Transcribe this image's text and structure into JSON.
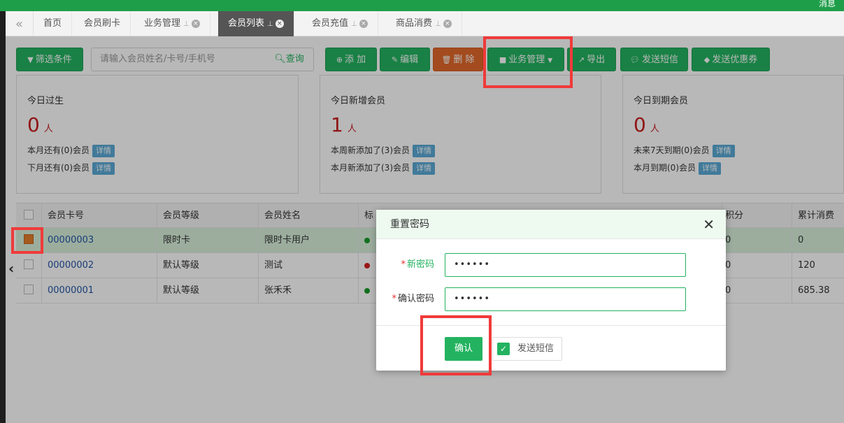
{
  "topbar": {
    "message": "消息"
  },
  "tabs": [
    {
      "label": "首页",
      "active": false
    },
    {
      "label": "会员刷卡",
      "active": false
    },
    {
      "label": "业务管理",
      "active": false
    },
    {
      "label": "会员列表",
      "active": true
    },
    {
      "label": "会员充值",
      "active": false
    },
    {
      "label": "商品消费",
      "active": false
    }
  ],
  "toolbar": {
    "filter_label": "筛选条件",
    "search_placeholder": "请输入会员姓名/卡号/手机号",
    "search_button": "查询",
    "add_label": "添 加",
    "edit_label": "编辑",
    "delete_label": "删 除",
    "business_label": "业务管理",
    "export_label": "导出",
    "sms_label": "发送短信",
    "coupon_label": "发送优惠券"
  },
  "cards": [
    {
      "title": "今日过生",
      "number": "0",
      "unit": "人",
      "lines": [
        {
          "text": "本月还有(0)会员",
          "badge": "详情"
        },
        {
          "text": "下月还有(0)会员",
          "badge": "详情"
        }
      ]
    },
    {
      "title": "今日新增会员",
      "number": "1",
      "unit": "人",
      "lines": [
        {
          "text": "本周新添加了(3)会员",
          "badge": "详情"
        },
        {
          "text": "本月新添加了(3)会员",
          "badge": "详情"
        }
      ]
    },
    {
      "title": "今日到期会员",
      "number": "0",
      "unit": "人",
      "lines": [
        {
          "text": "未来7天到期(0)会员",
          "badge": "详情"
        },
        {
          "text": "本月到期(0)会员",
          "badge": "详情"
        }
      ]
    }
  ],
  "table": {
    "headers": {
      "card_no": "会员卡号",
      "level": "会员等级",
      "name": "会员姓名",
      "mark": "标",
      "points": "积分",
      "total": "累计消费"
    },
    "rows": [
      {
        "card_no": "00000003",
        "level": "限时卡",
        "name": "限时卡用户",
        "status_color": "#1a9c2a",
        "points": "0",
        "total": "0",
        "selected": true
      },
      {
        "card_no": "00000002",
        "level": "默认等级",
        "name": "测试",
        "status_color": "#d42020",
        "points": "0",
        "total": "120",
        "selected": false
      },
      {
        "card_no": "00000001",
        "level": "默认等级",
        "name": "张禾禾",
        "status_color": "#1a9c2a",
        "points": "0",
        "total": "685.38",
        "selected": false
      }
    ]
  },
  "modal": {
    "title": "重置密码",
    "new_password_label": "新密码",
    "new_password_value": "••••••",
    "confirm_password_label": "确认密码",
    "confirm_password_value": "••••••",
    "confirm_button": "确认",
    "send_sms_label": "发送短信"
  },
  "colors": {
    "primary": "#23b360",
    "danger": "#e2682a",
    "highlight": "#f03a3a"
  }
}
